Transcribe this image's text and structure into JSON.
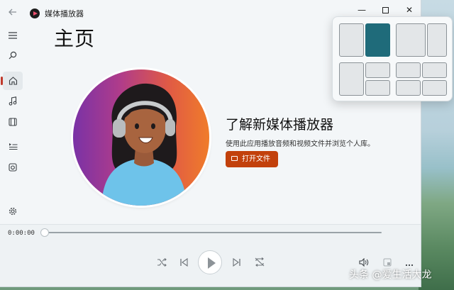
{
  "app": {
    "title": "媒体播放器"
  },
  "window_controls": {
    "minimize": "—",
    "close": "✕"
  },
  "sidebar": {
    "items": [
      {
        "icon": "hamburger-menu-icon"
      },
      {
        "icon": "search-icon"
      },
      {
        "icon": "home-icon",
        "active": true
      },
      {
        "icon": "music-note-icon"
      },
      {
        "icon": "video-film-icon"
      },
      {
        "icon": "play-queue-icon"
      },
      {
        "icon": "playlist-icon"
      },
      {
        "icon": "settings-icon"
      }
    ]
  },
  "main": {
    "page_title": "主页",
    "intro_heading": "了解新媒体播放器",
    "intro_description": "使用此应用播放音频和视频文件并浏览个人库。",
    "open_file_label": "打开文件"
  },
  "player": {
    "current_time": "0:00:00",
    "progress": 0
  },
  "colors": {
    "accent": "#c2410c",
    "snap_highlight": "#1f6b7a"
  },
  "watermark": "头条 @爱生活大龙"
}
